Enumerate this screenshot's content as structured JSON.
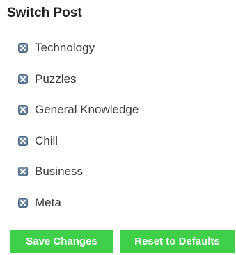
{
  "panel": {
    "title": "Switch Post"
  },
  "categories": [
    {
      "label": "Technology",
      "icon": "remove-x-icon"
    },
    {
      "label": "Puzzles",
      "icon": "remove-x-icon"
    },
    {
      "label": "General Knowledge",
      "icon": "remove-x-icon"
    },
    {
      "label": "Chill",
      "icon": "remove-x-icon"
    },
    {
      "label": "Business",
      "icon": "remove-x-icon"
    },
    {
      "label": "Meta",
      "icon": "remove-x-icon"
    }
  ],
  "actions": {
    "save_label": "Save Changes",
    "reset_label": "Reset to Defaults"
  },
  "colors": {
    "button_green": "#3fcf49",
    "remove_icon_blue": "#6a84a2"
  }
}
